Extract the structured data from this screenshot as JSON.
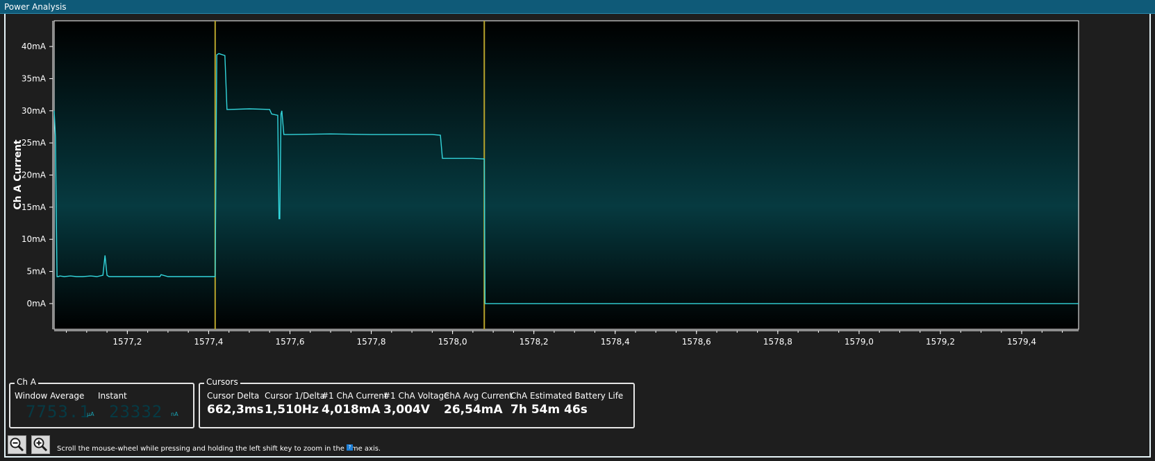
{
  "window": {
    "title": "Power Analysis"
  },
  "chart_data": {
    "type": "line",
    "title": "",
    "xlabel": "",
    "ylabel": "Ch A Current",
    "xlim": [
      1577.02,
      1579.54
    ],
    "ylim": [
      -4,
      44
    ],
    "x_ticks": [
      "1577,2",
      "1577,4",
      "1577,6",
      "1577,8",
      "1578,0",
      "1578,2",
      "1578,4",
      "1578,6",
      "1578,8",
      "1579,0",
      "1579,2",
      "1579,4"
    ],
    "x_tick_values": [
      1577.2,
      1577.4,
      1577.6,
      1577.8,
      1578.0,
      1578.2,
      1578.4,
      1578.6,
      1578.8,
      1579.0,
      1579.2,
      1579.4
    ],
    "y_ticks": [
      "0mA",
      "5mA",
      "10mA",
      "15mA",
      "20mA",
      "25mA",
      "30mA",
      "35mA",
      "40mA"
    ],
    "y_tick_values": [
      0,
      5,
      10,
      15,
      20,
      25,
      30,
      35,
      40
    ],
    "grid": false,
    "cursor_lines": [
      1577.416,
      1578.078
    ],
    "colors": {
      "trace": "#33d6dc",
      "cursor": "#b9a52c",
      "background_top": "#000000",
      "background_mid": "#063a40"
    },
    "series": [
      {
        "x": [
          1577.02,
          1577.023,
          1577.027,
          1577.03,
          1577.034,
          1577.045,
          1577.06,
          1577.075,
          1577.09,
          1577.11,
          1577.125,
          1577.14,
          1577.145,
          1577.15,
          1577.155,
          1577.16,
          1577.2,
          1577.25,
          1577.28,
          1577.283,
          1577.3,
          1577.35,
          1577.416,
          1577.42,
          1577.425,
          1577.44,
          1577.445,
          1577.45,
          1577.5,
          1577.55,
          1577.555,
          1577.57,
          1577.573,
          1577.575,
          1577.578,
          1577.58,
          1577.585,
          1577.6,
          1577.7,
          1577.8,
          1577.9,
          1577.95,
          1577.97,
          1577.975,
          1578.0,
          1578.05,
          1578.078,
          1578.08,
          1578.1,
          1578.5,
          1579.0,
          1579.54
        ],
        "y": [
          30,
          26,
          4.2,
          4.2,
          4.3,
          4.2,
          4.3,
          4.2,
          4.2,
          4.3,
          4.2,
          4.4,
          7.5,
          4.4,
          4.2,
          4.2,
          4.2,
          4.2,
          4.2,
          4.5,
          4.2,
          4.2,
          4.2,
          38.7,
          38.9,
          38.6,
          30.2,
          30.2,
          30.3,
          30.2,
          29.5,
          29.3,
          13.2,
          13.2,
          29.5,
          30.0,
          26.3,
          26.3,
          26.4,
          26.3,
          26.3,
          26.3,
          26.2,
          22.6,
          22.6,
          22.6,
          22.5,
          0.0,
          0.0,
          0.0,
          0.0,
          0.0
        ]
      }
    ]
  },
  "ch_a": {
    "title": "Ch A",
    "window_average_label": "Window Average",
    "window_average_value": "7753.1",
    "window_average_unit": "µA",
    "instant_label": "Instant",
    "instant_value": "23332",
    "instant_unit": "nA"
  },
  "cursors": {
    "title": "Cursors",
    "items": [
      {
        "label": "Cursor Delta",
        "value": "662,3ms"
      },
      {
        "label": "Cursor 1/Delta",
        "value": "1,510Hz"
      },
      {
        "label": "#1 ChA Current",
        "value": "4,018mA"
      },
      {
        "label": "#1 ChA Voltage",
        "value": "3,004V"
      },
      {
        "label": "ChA Avg Current",
        "value": "26,54mA"
      },
      {
        "label": "ChA Estimated Battery Life",
        "value": "7h 54m 46s"
      }
    ]
  },
  "toolbar": {
    "zoom_out_icon": "zoom-out-magnifier",
    "zoom_in_icon": "zoom-in-magnifier",
    "hint": "Scroll the mouse-wheel while pressing and holding the left shift key to zoom in the time axis.",
    "help_badge": "?"
  }
}
